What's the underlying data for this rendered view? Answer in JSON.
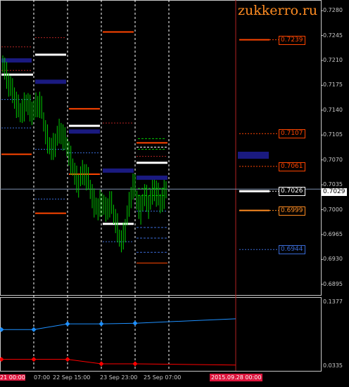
{
  "watermark": "zukkerro.ru",
  "colors": {
    "background": "#000000",
    "frame": "#c8c8c8",
    "candles": "#00cc00",
    "resistance": "#ff4500",
    "support_dashed": "#3a6bd6",
    "block_blue": "#1a1a80",
    "white_level": "#ffffff",
    "osc_blue": "#1e90ff",
    "osc_red": "#ff0000",
    "date_badge": "#dc143c"
  },
  "price_axis": {
    "ticks": [
      "0.7280",
      "0.7245",
      "0.7210",
      "0.7175",
      "0.7140",
      "0.7105",
      "0.7070",
      "0.7035",
      "0.7000",
      "0.6965",
      "0.6930",
      "0.6895"
    ],
    "current_price": "0.7029"
  },
  "level_labels": [
    {
      "text": "0.7239",
      "color": "#ff4500"
    },
    {
      "text": "0.7107",
      "color": "#ff4500"
    },
    {
      "text": "0.7061",
      "color": "#ff4500"
    },
    {
      "text": "0.7026",
      "color": "#ffffff"
    },
    {
      "text": "0.6999",
      "color": "#ff8c22"
    },
    {
      "text": "0.6944",
      "color": "#3a6bd6"
    }
  ],
  "oscillator_axis": {
    "ticks": [
      "0.1377",
      "0.0335"
    ]
  },
  "time_axis": {
    "labels": [
      "21 00:00",
      "07:00",
      "22 Sep 15:00",
      "23 Sep 23:00",
      "25 Sep 07:00"
    ],
    "future_date": "2015.09.28 00:00"
  },
  "chart_data": {
    "type": "candlestick",
    "symbol_timeframe_hint": "",
    "y_range": [
      0.688,
      0.7295
    ],
    "price_levels": {
      "resistance": [
        0.7239,
        0.7107,
        0.7061
      ],
      "pivot": 0.7026,
      "support": [
        0.6999,
        0.6944
      ]
    },
    "last_price": 0.7029,
    "oscillator": {
      "ylim": [
        0.0335,
        0.1377
      ],
      "series": [
        {
          "values": [
            0.092,
            0.092,
            0.101,
            0.101,
            0.102,
            0.109
          ]
        },
        {
          "values": [
            0.045,
            0.045,
            0.045,
            0.038,
            0.038,
            0.036
          ]
        }
      ]
    }
  }
}
